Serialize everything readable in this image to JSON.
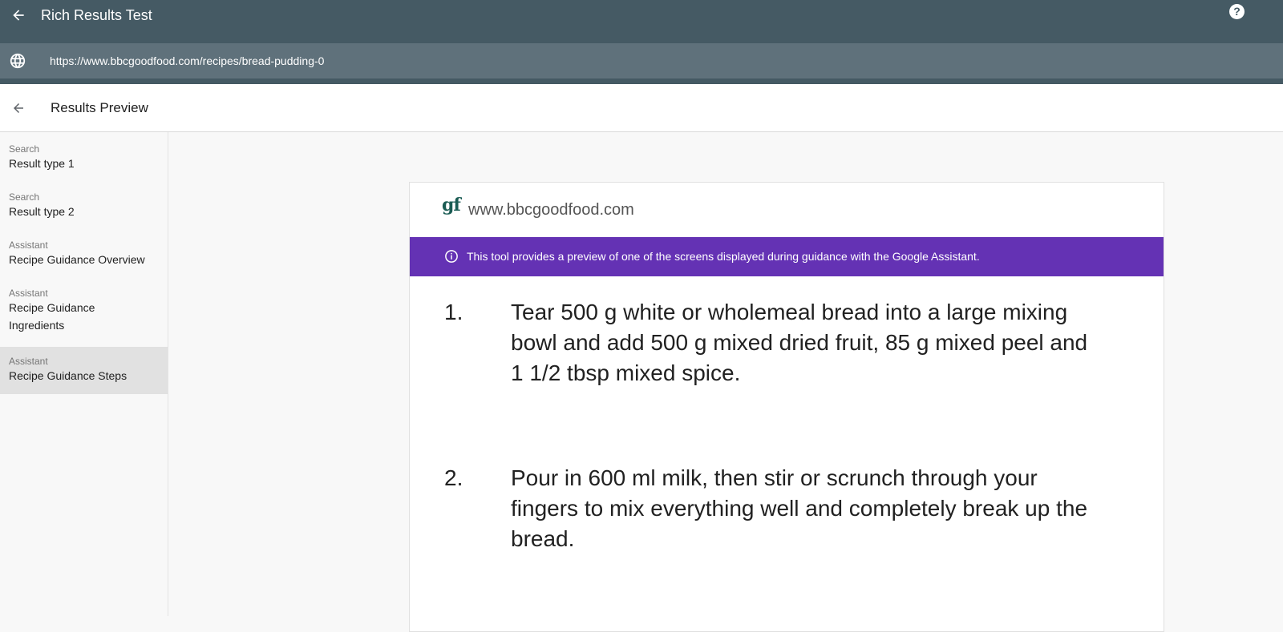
{
  "app": {
    "title": "Rich Results Test",
    "url": "https://www.bbcgoodfood.com/recipes/bread-pudding-0",
    "help_label": "?"
  },
  "subheader": {
    "title": "Results Preview"
  },
  "sidebar": {
    "items": [
      {
        "category": "Search",
        "label": "Result type 1",
        "selected": false
      },
      {
        "category": "Search",
        "label": "Result type 2",
        "selected": false
      },
      {
        "category": "Assistant",
        "label": "Recipe Guidance Overview",
        "selected": false
      },
      {
        "category": "Assistant",
        "label": "Recipe Guidance Ingredients",
        "selected": false
      },
      {
        "category": "Assistant",
        "label": "Recipe Guidance Steps",
        "selected": true
      }
    ]
  },
  "preview": {
    "logo_text": "gf",
    "domain": "www.bbcgoodfood.com",
    "banner_text": "This tool provides a preview of one of the screens displayed during guidance with the Google Assistant.",
    "banner_color": "#6432b4",
    "steps": [
      {
        "number": "1.",
        "text": "Tear 500 g white or wholemeal bread into a large mixing bowl and add 500 g mixed dried fruit, 85 g mixed peel and 1 1/2 tbsp mixed spice."
      },
      {
        "number": "2.",
        "text": "Pour in 600 ml milk, then stir or scrunch through your fingers to mix everything well and completely break up the bread."
      }
    ]
  },
  "colors": {
    "header_bg": "#455a64",
    "urlbar_bg": "#5f717b",
    "selected_bg": "#e1e1e1"
  }
}
